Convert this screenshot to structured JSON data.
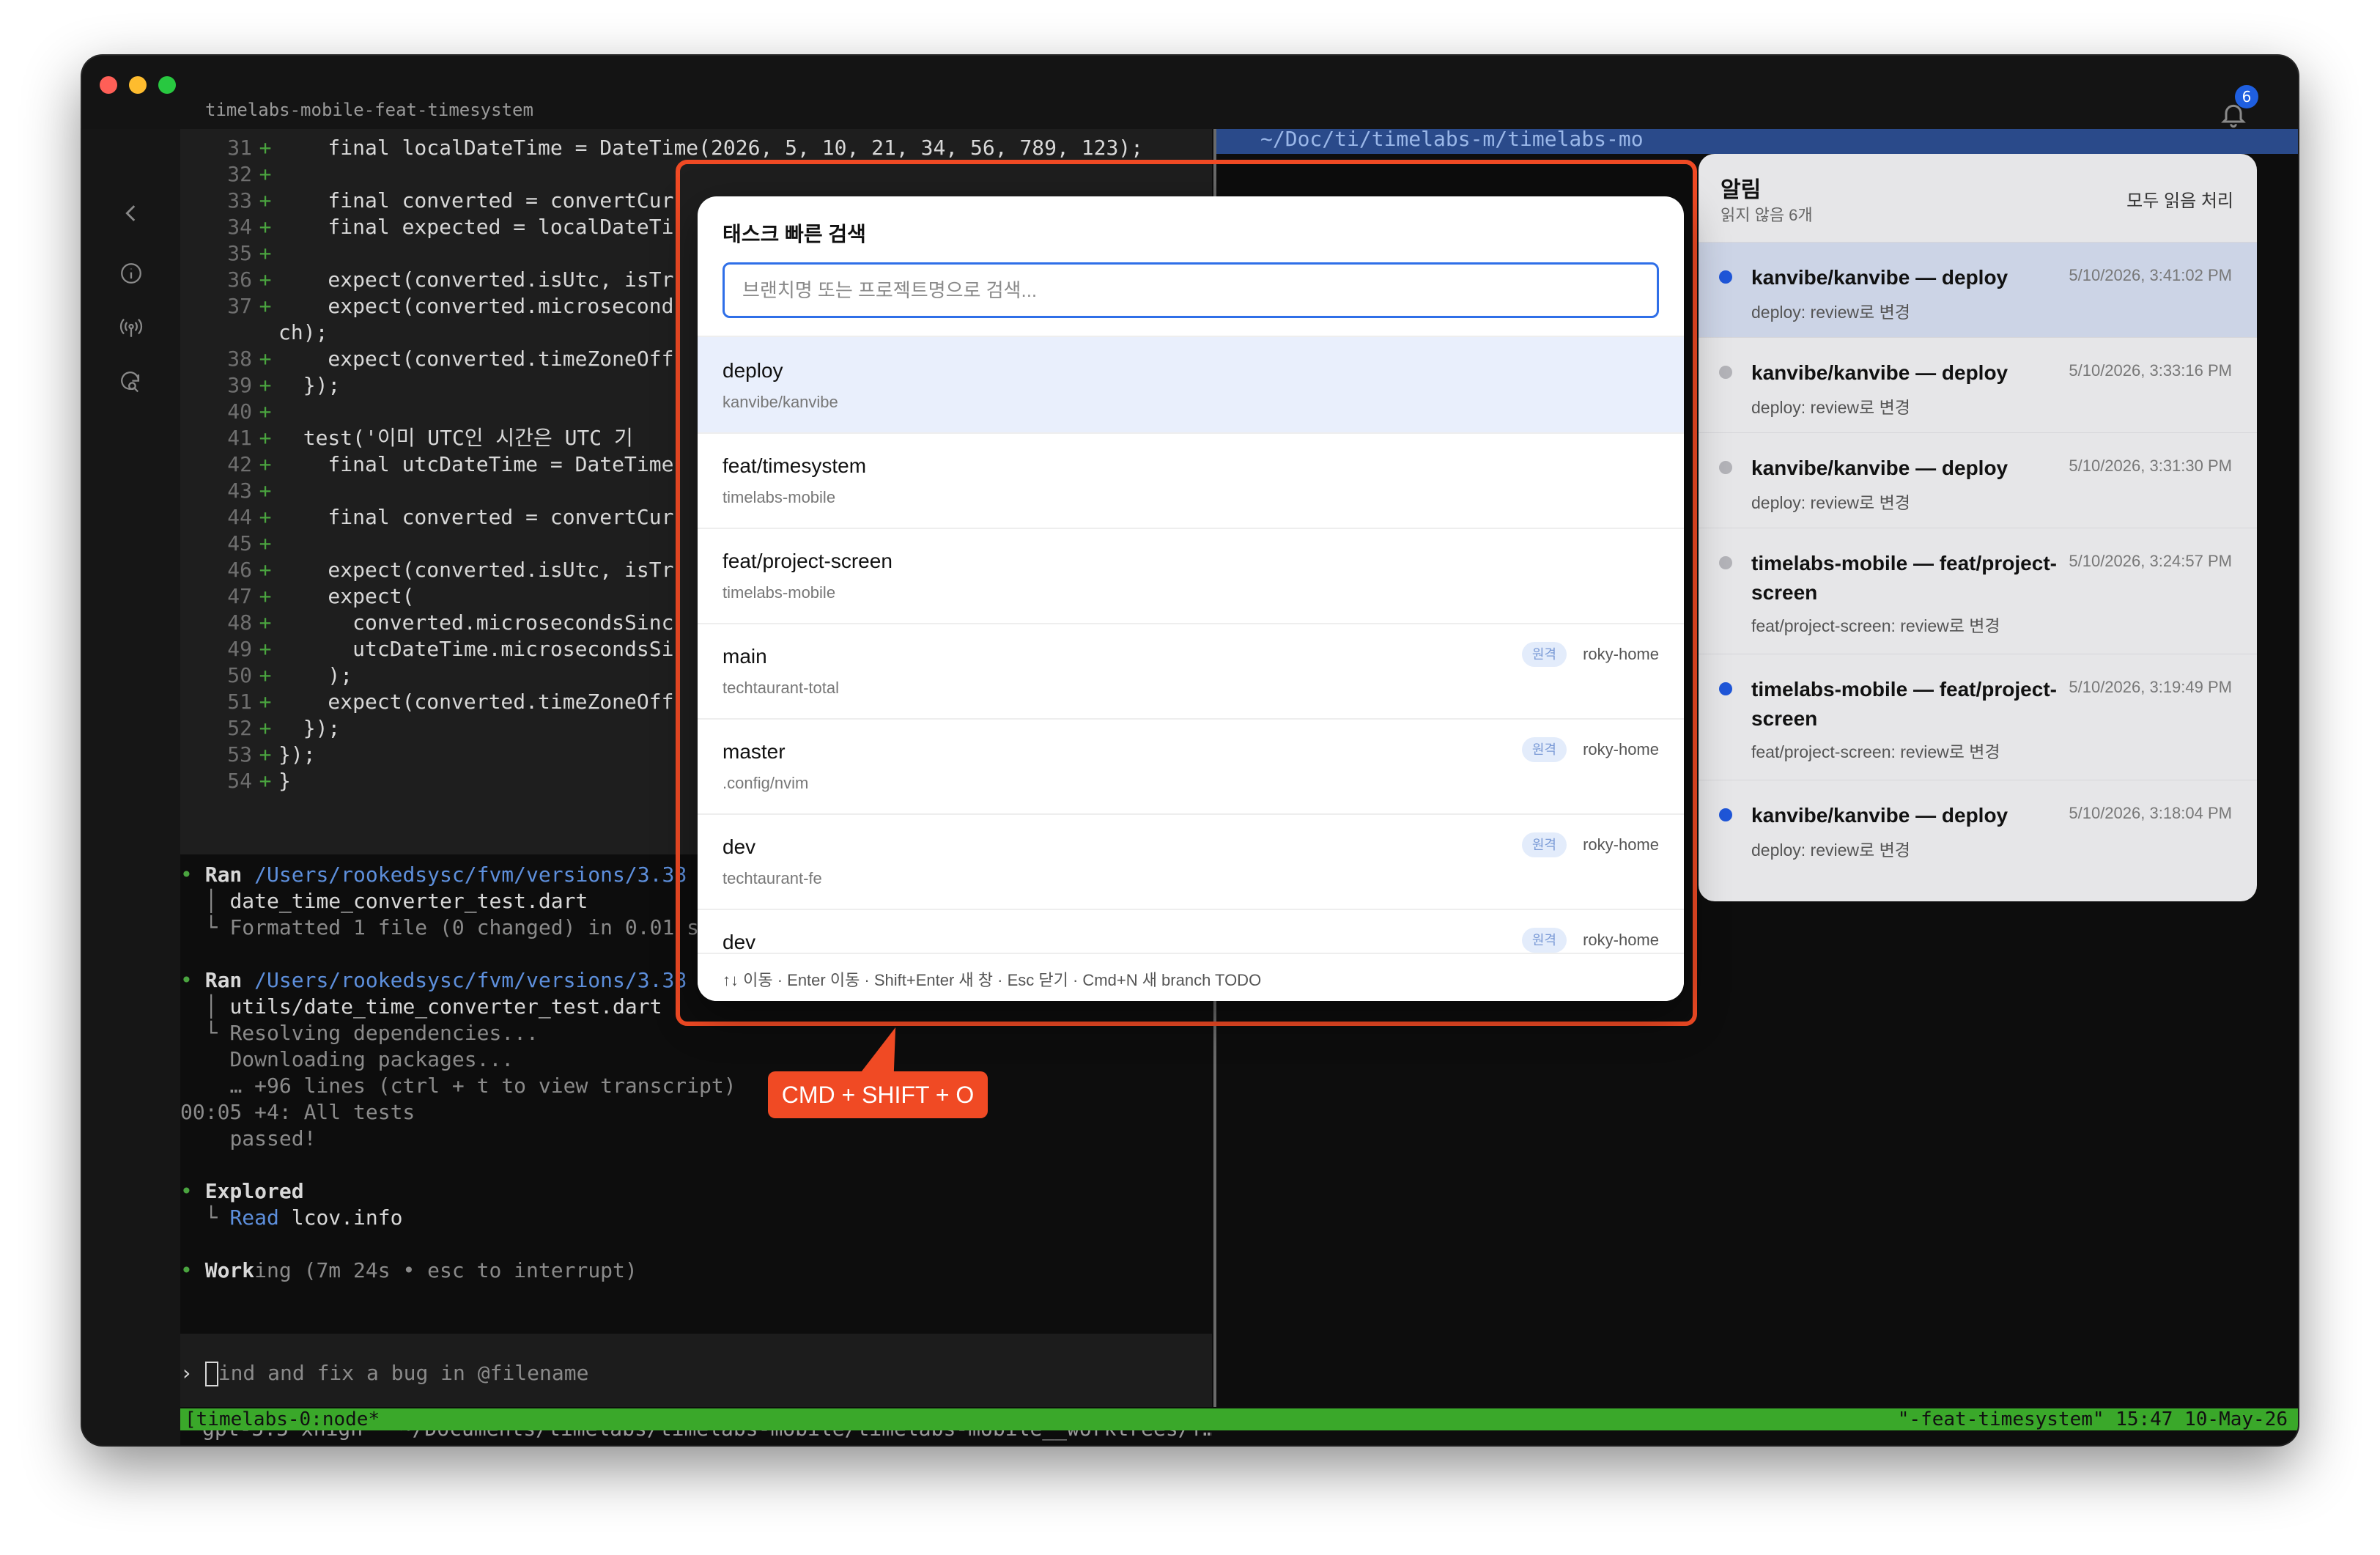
{
  "window": {
    "title": "timelabs-mobile-feat-timesystem",
    "notification_count": "6"
  },
  "sidebar": {
    "icons": [
      "chevron-left-icon",
      "info-icon",
      "broadcast-icon",
      "search-refresh-icon"
    ]
  },
  "terminal": {
    "diff_lines": [
      {
        "ln": "31",
        "text": "    final localDateTime = DateTime(2026, 5, 10, 21, 34, 56, 789, 123);"
      },
      {
        "ln": "32",
        "text": ""
      },
      {
        "ln": "33",
        "text": "    final converted = convertCur"
      },
      {
        "ln": "34",
        "text": "    final expected = localDateTi"
      },
      {
        "ln": "35",
        "text": ""
      },
      {
        "ln": "36",
        "text": "    expect(converted.isUtc, isTr"
      },
      {
        "ln": "37",
        "text": "    expect(converted.microsecond"
      },
      {
        "ln": "",
        "text": "ch);"
      },
      {
        "ln": "38",
        "text": "    expect(converted.timeZoneOff"
      },
      {
        "ln": "39",
        "text": "  });"
      },
      {
        "ln": "40",
        "text": ""
      },
      {
        "ln": "41",
        "text": "  test('이미 UTC인 시간은 UTC 기"
      },
      {
        "ln": "42",
        "text": "    final utcDateTime = DateTime"
      },
      {
        "ln": "43",
        "text": ""
      },
      {
        "ln": "44",
        "text": "    final converted = convertCur"
      },
      {
        "ln": "45",
        "text": ""
      },
      {
        "ln": "46",
        "text": "    expect(converted.isUtc, isTr"
      },
      {
        "ln": "47",
        "text": "    expect("
      },
      {
        "ln": "48",
        "text": "      converted.microsecondsSinc"
      },
      {
        "ln": "49",
        "text": "      utcDateTime.microsecondsSi"
      },
      {
        "ln": "50",
        "text": "    );"
      },
      {
        "ln": "51",
        "text": "    expect(converted.timeZoneOff"
      },
      {
        "ln": "52",
        "text": "  });"
      },
      {
        "ln": "53",
        "text": "});"
      },
      {
        "ln": "54",
        "text": "}"
      }
    ],
    "run1_label": "Ran",
    "run1_path": "/Users/rookedsysc/fvm/versions/3.38",
    "run1_file": "date_time_converter_test.dart",
    "run1_result": "Formatted 1 file (0 changed) in 0.01 s",
    "run2_label": "Ran",
    "run2_path": "/Users/rookedsysc/fvm/versions/3.38",
    "run2_file": "utils/date_time_converter_test.dart",
    "run2_line1": "Resolving dependencies...",
    "run2_line2": "Downloading packages...",
    "run2_line3": "… +96 lines (ctrl + t to view transcript)",
    "run2_line4": "00:05 +4: All tests",
    "run2_line5": "passed!",
    "explored_label": "Explored",
    "explored_action": "Read",
    "explored_file": "lcov.info",
    "working_bright": "Work",
    "working_dim": "ing",
    "working_meta": "(7m 24s • esc to interrupt)",
    "prompt_placeholder": "ind and fix a bug in @filename",
    "model_line": "gpt-5.5 xhigh · ~/Documents/timelabs/timelabs-mobile/timelabs-mobile__worktrees/f…",
    "right_header": "~/Doc/ti/timelabs-m/timelabs-mo"
  },
  "statusbar": {
    "left": "[timelabs-0:node*",
    "right": "\"-feat-timesystem\" 15:47 10-May-26"
  },
  "notifications": {
    "title": "알림",
    "unread_summary": "읽지 않음 6개",
    "mark_all_read": "모두 읽음 처리",
    "items": [
      {
        "title": "kanvibe/kanvibe — deploy",
        "time": "5/10/2026, 3:41:02 PM",
        "message": "deploy: review로 변경",
        "unread": true,
        "active": true
      },
      {
        "title": "kanvibe/kanvibe — deploy",
        "time": "5/10/2026, 3:33:16 PM",
        "message": "deploy: review로 변경",
        "unread": false,
        "active": false
      },
      {
        "title": "kanvibe/kanvibe — deploy",
        "time": "5/10/2026, 3:31:30 PM",
        "message": "deploy: review로 변경",
        "unread": false,
        "active": false
      },
      {
        "title": "timelabs-mobile — feat/project-screen",
        "time": "5/10/2026, 3:24:57 PM",
        "message": "feat/project-screen: review로 변경",
        "unread": false,
        "active": false
      },
      {
        "title": "timelabs-mobile — feat/project-screen",
        "time": "5/10/2026, 3:19:49 PM",
        "message": "feat/project-screen: review로 변경",
        "unread": true,
        "active": false
      },
      {
        "title": "kanvibe/kanvibe — deploy",
        "time": "5/10/2026, 3:18:04 PM",
        "message": "deploy: review로 변경",
        "unread": true,
        "active": false
      }
    ]
  },
  "quick_search": {
    "title": "태스크 빠른 검색",
    "placeholder": "브랜치명 또는 프로젝트명으로 검색...",
    "remote_label": "원격",
    "results": [
      {
        "branch": "deploy",
        "project": "kanvibe/kanvibe",
        "remote": "",
        "selected": true
      },
      {
        "branch": "feat/timesystem",
        "project": "timelabs-mobile",
        "remote": "",
        "selected": false
      },
      {
        "branch": "feat/project-screen",
        "project": "timelabs-mobile",
        "remote": "",
        "selected": false
      },
      {
        "branch": "main",
        "project": "techtaurant-total",
        "remote": "roky-home",
        "selected": false
      },
      {
        "branch": "master",
        "project": ".config/nvim",
        "remote": "roky-home",
        "selected": false
      },
      {
        "branch": "dev",
        "project": "techtaurant-fe",
        "remote": "roky-home",
        "selected": false
      },
      {
        "branch": "dev",
        "project": "",
        "remote": "roky-home",
        "selected": false
      }
    ],
    "footer_hint": "↑↓ 이동 · Enter 이동 · Shift+Enter 새 창 · Esc 닫기 · Cmd+N 새 branch TODO"
  },
  "callout": {
    "shortcut": "CMD + SHIFT + O"
  },
  "colors": {
    "accent": "#2f6fe8",
    "callout": "#f04a24",
    "status_bar": "#3aa82a"
  }
}
